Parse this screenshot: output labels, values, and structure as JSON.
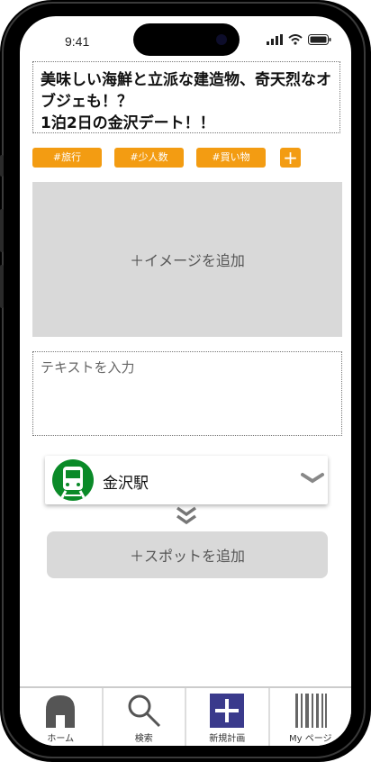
{
  "status_bar": {
    "time": "9:41"
  },
  "plan": {
    "title": "美味しい海鮮と立派な建造物、奇天烈なオブジェも！？\n1泊2日の金沢デート！！",
    "tags": [
      "#旅行",
      "#少人数",
      "#買い物"
    ],
    "tag_add_label": "+",
    "image_placeholder": "＋イメージを追加",
    "text_placeholder": "テキストを入力"
  },
  "spot": {
    "station_name": "金沢駅",
    "icon": "train-icon",
    "add_spot_label": "＋スポットを追加"
  },
  "tabbar": {
    "items": [
      {
        "label": "ホーム",
        "icon": "home-icon"
      },
      {
        "label": "検索",
        "icon": "search-icon"
      },
      {
        "label": "新規計画",
        "icon": "plus-icon"
      },
      {
        "label": "My ページ",
        "icon": "barcode-icon"
      }
    ]
  },
  "colors": {
    "tag": "#f39c12",
    "placeholder_bg": "#d9d9d9",
    "train": "#0a8a28",
    "new_plan": "#3a3a8c"
  }
}
